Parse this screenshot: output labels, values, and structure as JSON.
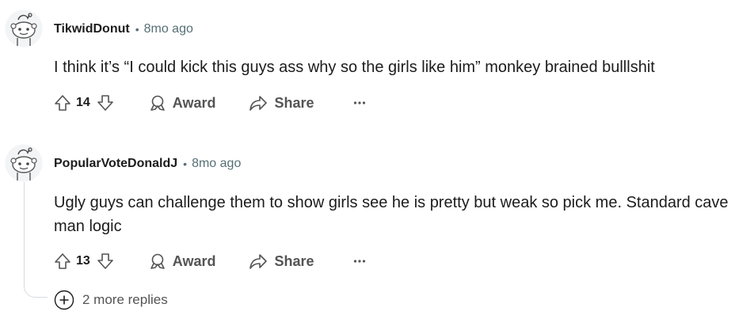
{
  "comments": [
    {
      "author": "TikwidDonut",
      "separator": "•",
      "time": "8mo ago",
      "body": "I think it’s “I could kick this guys ass why so the girls like him” monkey brained bulllshit",
      "score": "14",
      "award_label": "Award",
      "share_label": "Share"
    },
    {
      "author": "PopularVoteDonaldJ",
      "separator": "•",
      "time": "8mo ago",
      "body": "Ugly guys can challenge them to show girls see he is pretty but weak so pick me. Standard cave man logic",
      "score": "13",
      "award_label": "Award",
      "share_label": "Share"
    }
  ],
  "more_replies": {
    "label": "2 more replies"
  },
  "colors": {
    "text": "#1c1c1c",
    "muted": "#576f76",
    "action": "#545454",
    "thread": "#d7dbe0"
  },
  "icons": [
    "avatar-icon",
    "upvote-icon",
    "downvote-icon",
    "award-icon",
    "share-icon",
    "more-options-icon",
    "plus-circle-icon"
  ]
}
